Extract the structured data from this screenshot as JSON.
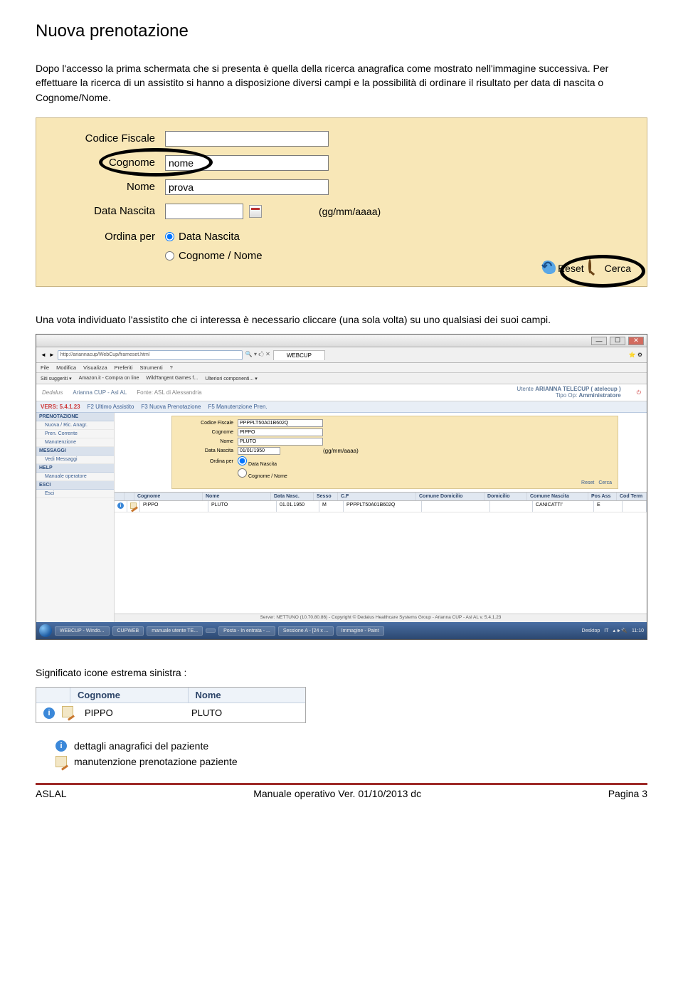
{
  "title": "Nuova prenotazione",
  "paragraphs": {
    "p1": "Dopo l'accesso la prima schermata che si presenta è quella della ricerca anagrafica come mostrato nell'immagine successiva. Per effettuare la ricerca di un assistito si hanno a disposizione diversi campi e la possibilità di ordinare il risultato per data di nascita o Cognome/Nome.",
    "p2": "Una vota individuato l'assistito che ci interessa è necessario cliccare (una sola volta) su uno qualsiasi dei suoi campi.",
    "legend_title": "Significato  icone estrema sinistra :"
  },
  "form": {
    "labels": {
      "cf": "Codice Fiscale",
      "cognome": "Cognome",
      "nome": "Nome",
      "data_nascita": "Data Nascita",
      "ordina_per": "Ordina per"
    },
    "values": {
      "cf": "",
      "cognome": "nome",
      "nome": "prova",
      "data_nascita": ""
    },
    "date_hint": "(gg/mm/aaaa)",
    "radio_data": "Data Nascita",
    "radio_nome": "Cognome / Nome",
    "reset": "Reset",
    "cerca": "Cerca"
  },
  "browser": {
    "url": "http://ariannacup/WebCup/frameset.html",
    "tab": "WEBCUP",
    "menus": [
      "File",
      "Modifica",
      "Visualizza",
      "Preferiti",
      "Strumenti",
      "?"
    ],
    "fav": [
      "Siti suggeriti ▾",
      "Amazon.it - Compra on line",
      "WildTangent Games f...",
      "Ulteriori componenti... ▾"
    ],
    "brand": "Dedalus",
    "app": "Arianna CUP - Asl AL",
    "fonte": "Fonte: ASL di Alessandria",
    "user_lbl": "Utente",
    "user_val": "ARIANNA TELECUP ( atelecup )",
    "role_lbl": "Tipo Op:",
    "role_val": "Amministratore",
    "version": "VERS: 5.4.1.23",
    "fn": [
      "F2 Ultimo Assistito",
      "F3 Nuova Prenotazione",
      "F5 Manutenzione Pren."
    ],
    "side": {
      "PRENOTAZIONE": [
        "Nuova / Ric. Anagr.",
        "Pren. Corrente",
        "Manutenzione"
      ],
      "MESSAGGI": [
        "Vedi Messaggi"
      ],
      "HELP": [
        "Manuale operatore"
      ],
      "ESCI": [
        "Esci"
      ]
    },
    "miniform": {
      "cf": "PPPPLT50A01B602Q",
      "cognome": "PIPPO",
      "nome": "PLUTO",
      "data": "01/01/1950"
    },
    "table": {
      "headers": [
        "Cognome",
        "Nome",
        "Data Nasc.",
        "Sesso",
        "C.F",
        "Comune Domicilio",
        "Domicilio",
        "Comune Nascita",
        "Pos Ass",
        "Cod Term"
      ],
      "row": {
        "cognome": "PIPPO",
        "nome": "PLUTO",
        "data": "01.01.1950",
        "sesso": "M",
        "cf": "PPPPLT50A01B602Q",
        "com_dom": "",
        "dom": "",
        "com_nas": "CANICATTI'",
        "pos": "E",
        "cod": ""
      }
    },
    "server_foot": "Server: NETTUNO (10.70.80.86) - Copyright © Dedalus Healthcare Systems Group - Arianna CUP - Asl AL v. 5.4.1.23",
    "taskbar": [
      "WEBCUP - Windo...",
      "CUPWEB",
      "manuale utente TE...",
      "",
      "Posta - In entrata - ...",
      "Sessione A - [24 x ...",
      "Immagine - Paint"
    ],
    "tb_right": {
      "desk": "Desktop",
      "lang": "IT",
      "time": "11:10"
    }
  },
  "legend_table": {
    "headers": [
      "Cognome",
      "Nome"
    ],
    "row": [
      "PIPPO",
      "PLUTO"
    ]
  },
  "legend_items": {
    "info": "dettagli anagrafici del paziente",
    "edit": "manutenzione  prenotazione paziente"
  },
  "footer": {
    "left": "ASLAL",
    "center": "Manuale operativo Ver. 01/10/2013 dc",
    "right": "Pagina 3"
  }
}
